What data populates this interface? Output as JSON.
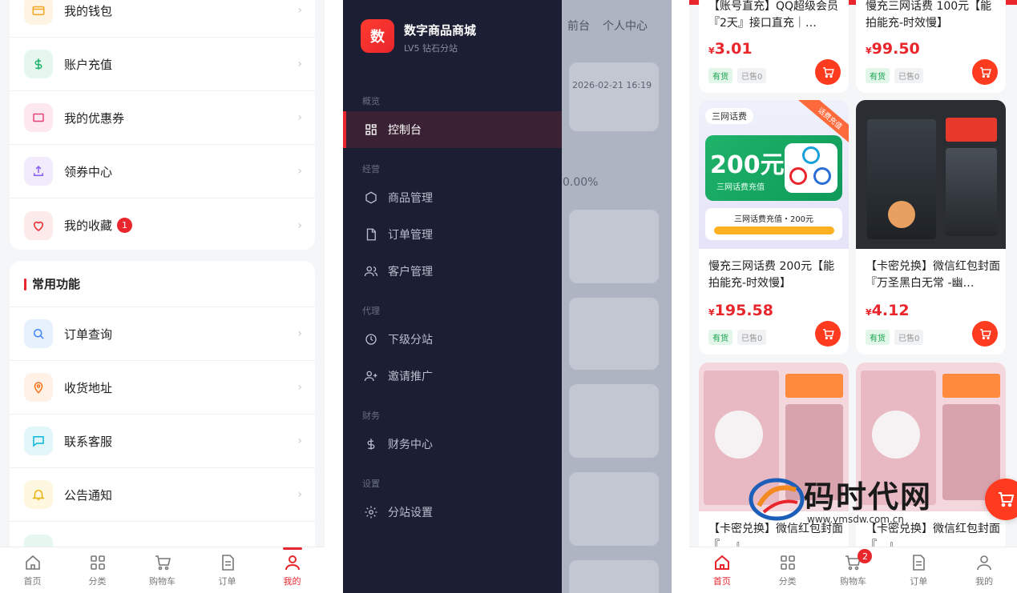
{
  "colors": {
    "accent": "#e8262c",
    "drawer_bg": "#1c1f33",
    "in_stock_green": "#14a44d"
  },
  "panel1": {
    "menu1": [
      {
        "label": "我的钱包",
        "icon": "wallet-icon",
        "bg": "#fff4e3",
        "fg": "#f5a623"
      },
      {
        "label": "账户充值",
        "icon": "dollar-icon",
        "bg": "#e5f7ee",
        "fg": "#1db36b"
      },
      {
        "label": "我的优惠券",
        "icon": "coupon-icon",
        "bg": "#fde8ef",
        "fg": "#e8407a"
      },
      {
        "label": "领券中心",
        "icon": "upload-icon",
        "bg": "#f1ebfb",
        "fg": "#8b5cf6"
      },
      {
        "label": "我的收藏",
        "icon": "heart-icon",
        "bg": "#fdeaea",
        "fg": "#e8262c",
        "badge": "1"
      }
    ],
    "section_title": "常用功能",
    "menu2": [
      {
        "label": "订单查询",
        "icon": "search-icon",
        "bg": "#e7f0fd",
        "fg": "#3b82f6"
      },
      {
        "label": "收货地址",
        "icon": "location-icon",
        "bg": "#fff1e6",
        "fg": "#f97316"
      },
      {
        "label": "联系客服",
        "icon": "chat-icon",
        "bg": "#e3f7fb",
        "fg": "#06b6d4"
      },
      {
        "label": "公告通知",
        "icon": "bell-icon",
        "bg": "#fff7e0",
        "fg": "#eab308"
      }
    ],
    "tabs": [
      {
        "label": "首页",
        "icon": "home-icon"
      },
      {
        "label": "分类",
        "icon": "grid-icon"
      },
      {
        "label": "购物车",
        "icon": "cart-icon"
      },
      {
        "label": "订单",
        "icon": "document-icon"
      },
      {
        "label": "我的",
        "icon": "user-icon",
        "active": true
      }
    ]
  },
  "panel2": {
    "bg_nav": {
      "front": "前台",
      "personal": "个人中心"
    },
    "bg_timestamp": "2026-02-21 16:19",
    "bg_percent": "0.00%",
    "logo_char": "数",
    "brand": "数字商品商城",
    "brand_sub": "LV5 钻石分站",
    "groups": {
      "overview": "概览",
      "operation": "经营",
      "agent": "代理",
      "finance": "财务",
      "settings": "设置"
    },
    "items": {
      "dashboard": "控制台",
      "products": "商品管理",
      "orders": "订单管理",
      "customers": "客户管理",
      "sub_sites": "下级分站",
      "invite": "邀请推广",
      "finance_center": "财务中心",
      "site_settings": "分站设置"
    }
  },
  "panel3": {
    "products": [
      {
        "title": "【账号直充】QQ超级会员『2天』接口直充｜…",
        "price": "3.01",
        "stock": "有货",
        "sold": "已售0"
      },
      {
        "title": "慢充三网话费 100元【能拍能充-时效慢】",
        "price": "99.50",
        "stock": "有货",
        "sold": "已售0"
      },
      {
        "title": "慢充三网话费 200元【能拍能充-时效慢】",
        "price": "195.58",
        "stock": "有货",
        "sold": "已售0",
        "img": {
          "brand": "三网话费",
          "ribbon": "话费充值",
          "amount": "200元",
          "sub": "三网话费充值",
          "bottom": "三网话费充值・200元"
        }
      },
      {
        "title": "【卡密兑换】微信红包封面『万圣黑白无常 -幽…",
        "price": "4.12",
        "stock": "有货",
        "sold": "已售0"
      },
      {
        "title": "【卡密兑换】微信红包封面『… 』",
        "price": "",
        "stock": "",
        "sold": ""
      },
      {
        "title": "【卡密兑换】微信红包封面『…』",
        "price": "",
        "stock": "",
        "sold": ""
      }
    ],
    "currency": "¥",
    "tabs": [
      {
        "label": "首页",
        "icon": "home-icon",
        "active": true
      },
      {
        "label": "分类",
        "icon": "grid-icon"
      },
      {
        "label": "购物车",
        "icon": "cart-icon",
        "badge": "2"
      },
      {
        "label": "订单",
        "icon": "document-icon"
      },
      {
        "label": "我的",
        "icon": "user-icon"
      }
    ],
    "watermark": {
      "name": "码时代网",
      "url": "www.ymsdw.com.cn"
    }
  }
}
